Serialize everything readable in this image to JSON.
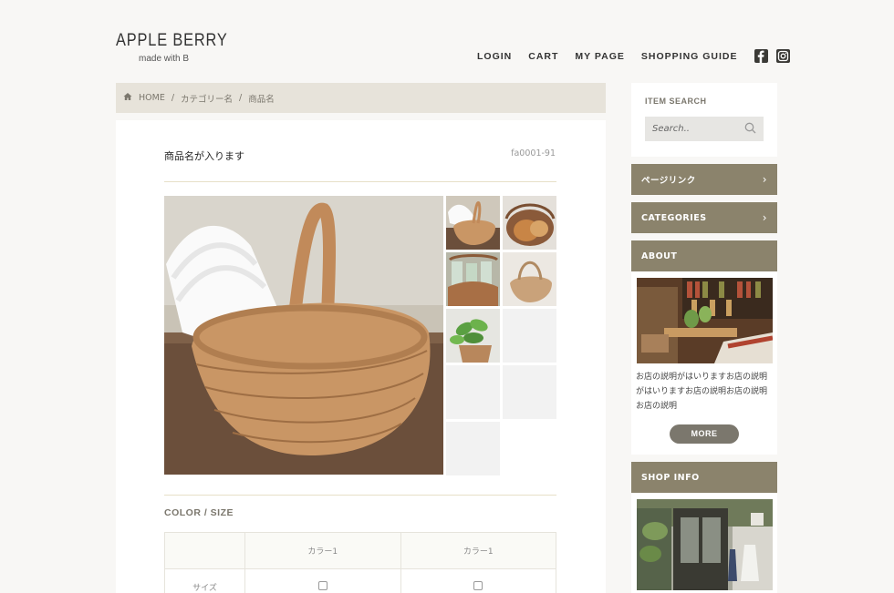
{
  "brand": {
    "title": "APPLE BERRY",
    "subtitle": "made with B"
  },
  "nav": {
    "items": [
      "LOGIN",
      "CART",
      "MY PAGE",
      "SHOPPING GUIDE"
    ],
    "social_icons": [
      "facebook-icon",
      "instagram-icon"
    ]
  },
  "breadcrumb": {
    "home_icon": "home-icon",
    "home": "HOME",
    "sep": "/",
    "category": "カテゴリー名",
    "product": "商品名"
  },
  "product": {
    "name": "商品名が入ります",
    "code": "fa0001-91",
    "thumbnails": [
      "wicker-basket-towel",
      "bread-basket",
      "glass-jars-basket",
      "handled-basket",
      "potted-plant",
      "empty",
      "empty",
      "empty",
      "empty"
    ]
  },
  "color_size": {
    "title": "COLOR / SIZE",
    "columns": [
      "",
      "カラー1",
      "カラー1"
    ],
    "rows": [
      {
        "label": "サイズ",
        "options": [
          false,
          false
        ]
      }
    ]
  },
  "sidebar": {
    "search_title": "ITEM SEARCH",
    "search_placeholder": "Search..",
    "links": [
      {
        "label": "ページリンク"
      },
      {
        "label": "CATEGORIES"
      }
    ],
    "about_title": "ABOUT",
    "about_text": "お店の説明がはいりますお店の説明がはいりますお店の説明お店の説明お店の説明",
    "more_label": "MORE",
    "shop_title": "SHOP INFO"
  },
  "colors": {
    "accent": "#8b836c",
    "breadcrumb_bg": "#e7e3da",
    "page_bg": "#f8f7f5"
  }
}
